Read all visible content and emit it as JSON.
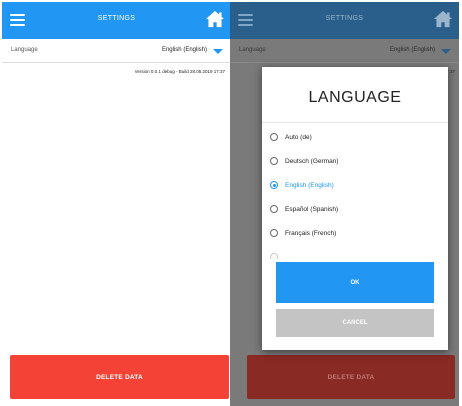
{
  "screens": {
    "settings": {
      "title": "SETTINGS",
      "language_label": "Language",
      "language_value": "English (English)",
      "version_text": "Version 0.0.1 debug - Build 28.05.2019 17:37",
      "delete_label": "DELETE DATA"
    },
    "dialog_screen": {
      "title": "SETTINGS",
      "language_label": "Language",
      "language_value": "English (English)",
      "version_partial": "17:37",
      "delete_label": "DELETE DATA",
      "dialog": {
        "title": "LANGUAGE",
        "options": [
          {
            "label": "Auto (de)",
            "selected": false
          },
          {
            "label": "Deutsch (German)",
            "selected": false
          },
          {
            "label": "English (English)",
            "selected": true
          },
          {
            "label": "Español (Spanish)",
            "selected": false
          },
          {
            "label": "Français (French)",
            "selected": false
          }
        ],
        "ok_label": "OK",
        "cancel_label": "CANCEL"
      }
    }
  },
  "colors": {
    "primary": "#2196f3",
    "danger": "#f44336",
    "cancel_gray": "#c4c4c4"
  },
  "icons": [
    "hamburger-menu-icon",
    "home-icon",
    "dropdown-caret-icon",
    "radio-icon"
  ]
}
